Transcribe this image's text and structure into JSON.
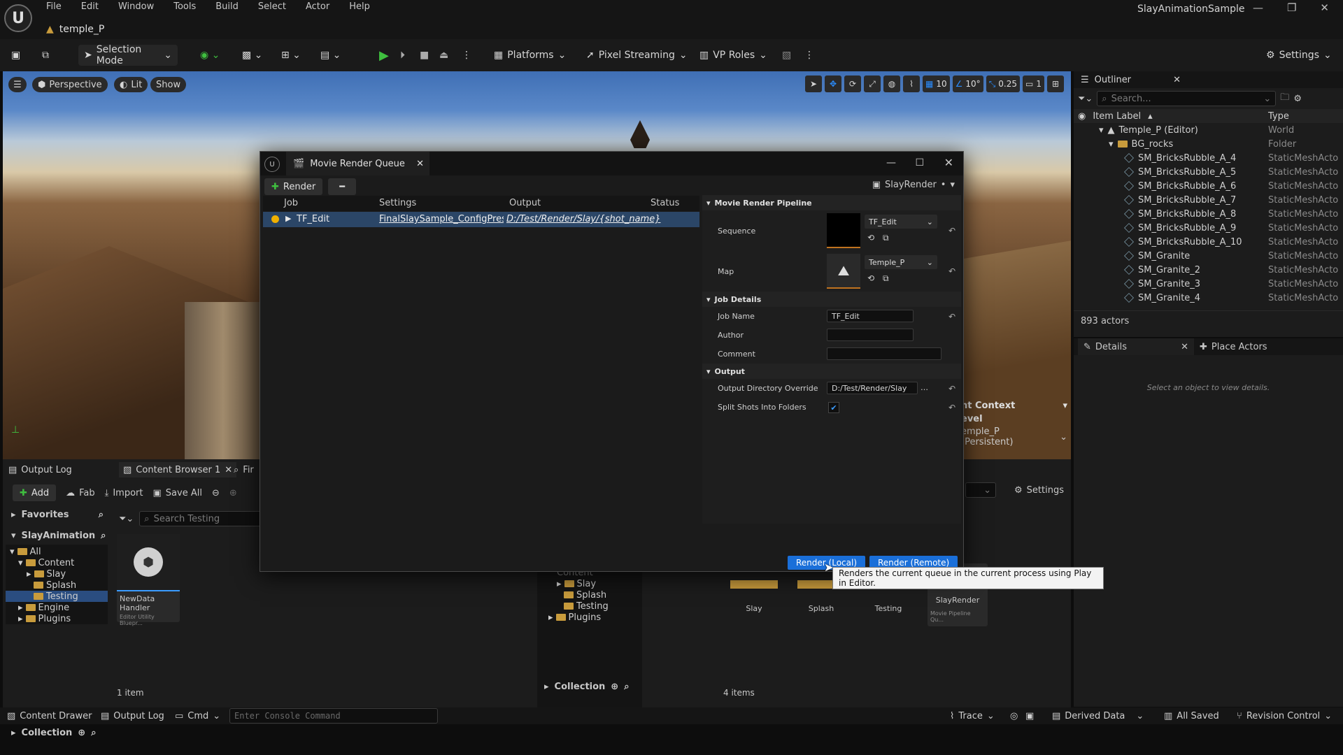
{
  "app": {
    "title": "SlayAnimationSample",
    "map_tab": "temple_P",
    "menus": [
      "File",
      "Edit",
      "Window",
      "Tools",
      "Build",
      "Select",
      "Actor",
      "Help"
    ]
  },
  "toolbar": {
    "mode": "Selection Mode",
    "platforms": "Platforms",
    "pixel_streaming": "Pixel Streaming",
    "vp_roles": "VP Roles",
    "settings": "Settings"
  },
  "viewport": {
    "perspective": "Perspective",
    "lit": "Lit",
    "show": "Show",
    "grid_size": "10",
    "rotation_snap": "10°",
    "scale_snap": "0.25",
    "camera_speed": "1",
    "level_context_partial": "nt Context",
    "level_partial": "evel",
    "persistent_partial": "emple_P (Persistent)"
  },
  "outliner": {
    "title": "Outliner",
    "search_placeholder": "Search...",
    "col_label": "Item Label",
    "col_type": "Type",
    "rows": [
      {
        "label": "Temple_P (Editor)",
        "type": "World"
      },
      {
        "label": "BG_rocks",
        "type": "Folder"
      },
      {
        "label": "SM_BricksRubble_A_4",
        "type": "StaticMeshActo"
      },
      {
        "label": "SM_BricksRubble_A_5",
        "type": "StaticMeshActo"
      },
      {
        "label": "SM_BricksRubble_A_6",
        "type": "StaticMeshActo"
      },
      {
        "label": "SM_BricksRubble_A_7",
        "type": "StaticMeshActo"
      },
      {
        "label": "SM_BricksRubble_A_8",
        "type": "StaticMeshActo"
      },
      {
        "label": "SM_BricksRubble_A_9",
        "type": "StaticMeshActo"
      },
      {
        "label": "SM_BricksRubble_A_10",
        "type": "StaticMeshActo"
      },
      {
        "label": "SM_Granite",
        "type": "StaticMeshActo"
      },
      {
        "label": "SM_Granite_2",
        "type": "StaticMeshActo"
      },
      {
        "label": "SM_Granite_3",
        "type": "StaticMeshActo"
      },
      {
        "label": "SM_Granite_4",
        "type": "StaticMeshActo"
      }
    ],
    "count": "893 actors"
  },
  "details": {
    "tab_details": "Details",
    "tab_place": "Place Actors",
    "empty": "Select an object to view details."
  },
  "left_panels": {
    "output_log": "Output Log",
    "content_browser": "Content Browser 1",
    "find_partial": "Fir",
    "add": "Add",
    "fab": "Fab",
    "import": "Import",
    "save_all": "Save All",
    "favorites": "Favorites",
    "search_placeholder": "Search Testing",
    "project": "SlayAnimation",
    "tree": [
      "All",
      "Content",
      "Slay",
      "Splash",
      "Testing",
      "Engine",
      "Plugins"
    ],
    "asset_name": "NewData Handler",
    "asset_type": "Editor Utility Bluepr...",
    "collection": "Collection",
    "item_count": "1 item"
  },
  "right_cb": {
    "tree": [
      "Content",
      "Slay",
      "Splash",
      "Testing",
      "Plugins"
    ],
    "settings": "Settings",
    "assets": [
      {
        "name": "Slay",
        "type": ""
      },
      {
        "name": "Splash",
        "type": ""
      },
      {
        "name": "Testing",
        "type": ""
      },
      {
        "name": "SlayRender",
        "type": "Movie Pipeline Qu..."
      }
    ],
    "collection": "Collection",
    "item_count": "4 items"
  },
  "mrq": {
    "title": "Movie Render Queue",
    "render_btn": "Render",
    "preset": "SlayRender",
    "columns": [
      "Job",
      "Settings",
      "Output",
      "Status"
    ],
    "job": {
      "name": "TF_Edit",
      "settings": "FinalSlaySample_ConfigPreset",
      "output": "D:/Test/Render/Slay/{shot_name}",
      "status": ""
    },
    "sections": {
      "pipeline": "Movie Render Pipeline",
      "job_details": "Job Details",
      "output": "Output"
    },
    "sequence_label": "Sequence",
    "sequence_value": "TF_Edit",
    "map_label": "Map",
    "map_value": "Temple_P",
    "job_name_label": "Job Name",
    "job_name_value": "TF_Edit",
    "author_label": "Author",
    "comment_label": "Comment",
    "output_dir_label": "Output Directory Override",
    "output_dir_value": "D:/Test/Render/Slay",
    "split_label": "Split Shots Into Folders",
    "split_checked": true,
    "render_local": "Render (Local)",
    "render_remote": "Render (Remote)",
    "tooltip": "Renders the current queue in the current process using Play in Editor."
  },
  "statusbar": {
    "content_drawer": "Content Drawer",
    "output_log": "Output Log",
    "cmd": "Cmd",
    "console_placeholder": "Enter Console Command",
    "trace": "Trace",
    "derived_data": "Derived Data",
    "all_saved": "All Saved",
    "revision_control": "Revision Control"
  }
}
